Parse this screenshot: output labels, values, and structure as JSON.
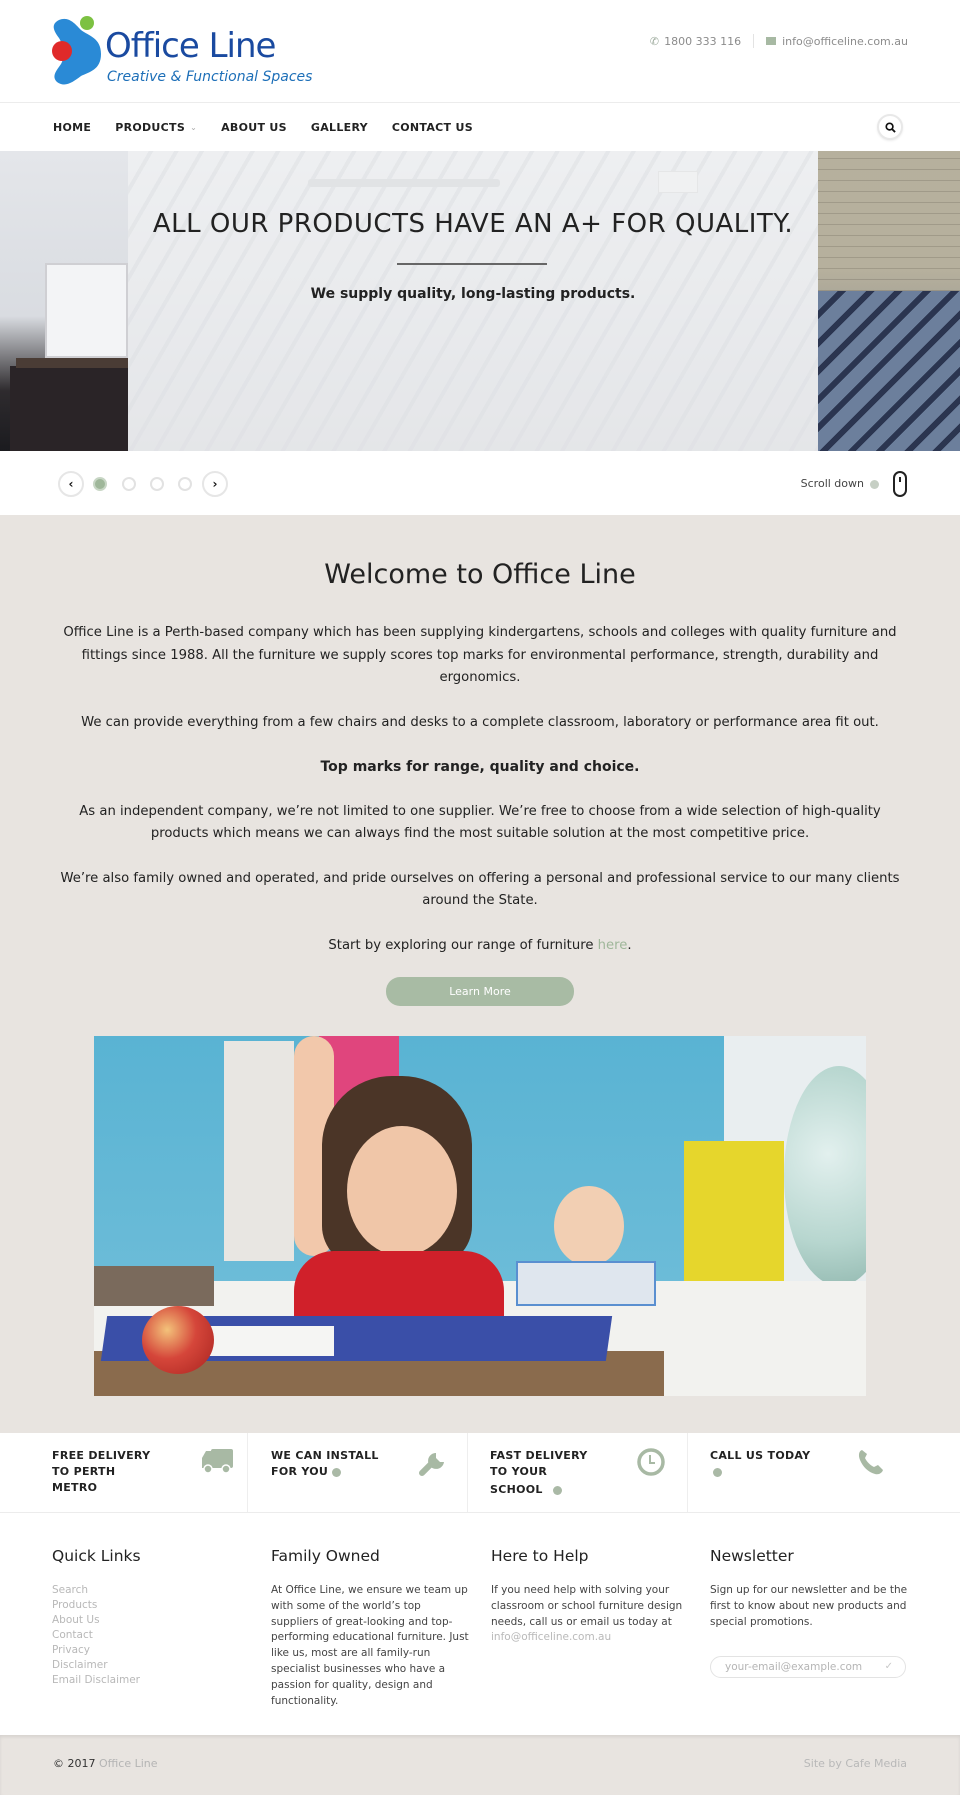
{
  "brand": {
    "name": "Office Line",
    "tagline": "Creative & Functional Spaces",
    "colors": {
      "blue": "#1a4aa0",
      "logo_blue": "#2a8ad6",
      "logo_red": "#e02a2a",
      "logo_green": "#7cc142",
      "accent": "#9fb79a",
      "button": "#a8bba4",
      "section_bg": "#e8e4e0"
    }
  },
  "header": {
    "phone_icon": "phone-icon",
    "phone": "1800 333 116",
    "email_icon": "envelope-icon",
    "email": "info@officeline.com.au"
  },
  "nav": {
    "items": [
      {
        "label": "HOME"
      },
      {
        "label": "PRODUCTS",
        "has_dropdown": true
      },
      {
        "label": "ABOUT US"
      },
      {
        "label": "GALLERY"
      },
      {
        "label": "CONTACT US"
      }
    ],
    "search_icon": "search-icon"
  },
  "hero": {
    "title": "ALL OUR PRODUCTS HAVE AN A+ FOR QUALITY.",
    "subtitle": "We supply quality, long-lasting products.",
    "slides_total": 4,
    "active_slide": 1,
    "prev_label": "‹",
    "next_label": "›",
    "scroll_label": "Scroll down"
  },
  "welcome": {
    "title": "Welcome to Office Line",
    "paragraphs": [
      "Office Line is a Perth-based company which has been supplying kindergartens, schools and colleges with quality furniture and fittings since 1988. All the furniture we supply scores top marks for environmental performance, strength, durability and ergonomics.",
      "We can provide everything from a few chairs and desks to a complete classroom, laboratory or performance area fit out.",
      "Top marks for range, quality and choice.",
      "As an independent company, we’re not limited to one supplier. We’re free to choose from a wide selection of high-quality products which means we can always find the most suitable solution at the most competitive price.",
      "We’re also family owned and operated, and pride ourselves on offering a personal and professional service to our many clients around the State."
    ],
    "cta_text": "Start by exploring our range of furniture ",
    "cta_link": "here",
    "cta_end": ".",
    "button": "Learn More",
    "image_alt": "Smiling girl raising her hand at a classroom desk"
  },
  "features": [
    {
      "lines": [
        "FREE DELIVERY",
        "TO PERTH",
        "METRO"
      ],
      "icon": "truck-icon",
      "has_arrow": false
    },
    {
      "lines": [
        "WE CAN INSTALL",
        "FOR YOU"
      ],
      "icon": "wrench-icon",
      "has_arrow": true
    },
    {
      "lines": [
        "FAST DELIVERY",
        "TO YOUR",
        "SCHOOL"
      ],
      "icon": "clock-icon",
      "has_arrow": true
    },
    {
      "lines": [
        "CALL US TODAY",
        ""
      ],
      "icon": "phone-icon",
      "has_arrow": true
    }
  ],
  "footer": {
    "quick_links": {
      "title": "Quick Links",
      "items": [
        "Search",
        "Products",
        "About Us",
        "Contact",
        "Privacy",
        "Disclaimer",
        "Email Disclaimer"
      ]
    },
    "family": {
      "title": "Family Owned",
      "text": "At Office Line, we ensure we team up with some of the world’s top suppliers of great-looking and top-performing educational furniture. Just like us, most are all family-run specialist businesses who have a passion for quality, design and functionality."
    },
    "help": {
      "title": "Here to Help",
      "text": "If you need help with solving your classroom or school furniture design needs, call us or email us today at ",
      "email": "info@officeline.com.au"
    },
    "newsletter": {
      "title": "Newsletter",
      "text": "Sign up for our newsletter and be the first to know about new products and special promotions.",
      "placeholder": "your-email@example.com",
      "submit_icon": "check-icon"
    }
  },
  "bottom": {
    "copyright": "© 2017 ",
    "copyright_link": "Office Line",
    "credit": "Site by Cafe Media"
  }
}
